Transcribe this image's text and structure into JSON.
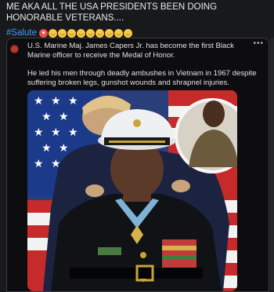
{
  "post": {
    "title": "ME AKA ALL THE USA PRESIDENTS BEEN DOING HONORABLE VETERANS....",
    "hashtag": "#Salute",
    "emojis": [
      "heart-eyes-emoji",
      "slight-smile-emoji",
      "slight-smile-emoji",
      "slight-smile-emoji",
      "slight-smile-emoji",
      "slight-smile-emoji",
      "slight-smile-emoji",
      "slight-smile-emoji",
      "slight-smile-emoji",
      "slight-smile-emoji"
    ]
  },
  "shared": {
    "paragraph1": "U.S. Marine Maj. James Capers Jr. has become the first Black Marine officer to receive the Medal of Honor.",
    "paragraph2": "He led his men through deadly ambushes in Vietnam in 1967 despite suffering broken legs, gunshot wounds and shrapnel injuries.",
    "more_icon": "more-dots-icon"
  },
  "colors": {
    "background": "#18191a",
    "hashtag": "#4599ff",
    "flag_blue": "#1b3a8a",
    "flag_red": "#c62a2a",
    "uniform": "#101216",
    "cap_white": "#eef0f2"
  }
}
